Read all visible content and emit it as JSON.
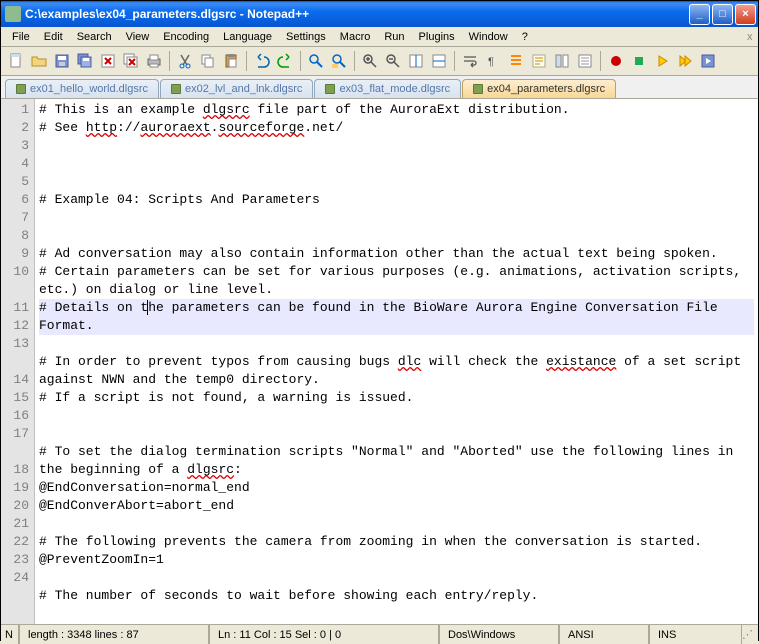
{
  "window": {
    "title": "C:\\examples\\ex04_parameters.dlgsrc - Notepad++"
  },
  "menu": {
    "items": [
      "File",
      "Edit",
      "Search",
      "View",
      "Encoding",
      "Language",
      "Settings",
      "Macro",
      "Run",
      "Plugins",
      "Window",
      "?"
    ]
  },
  "tabs": [
    {
      "label": "ex01_hello_world.dlgsrc",
      "active": false
    },
    {
      "label": "ex02_lvl_and_lnk.dlgsrc",
      "active": false
    },
    {
      "label": "ex03_flat_mode.dlgsrc",
      "active": false
    },
    {
      "label": "ex04_parameters.dlgsrc",
      "active": true
    }
  ],
  "editor": {
    "lines": [
      "# This is an example <sq>dlgsrc</sq> file part of the AuroraExt distribution.",
      "# See <sq>http</sq>://<sq>auroraext</sq>.<sq>sourceforge</sq>.net/",
      "",
      "",
      "",
      "# Example 04: Scripts And Parameters",
      "",
      "",
      "# Ad conversation may also contain information other than the actual text being spoken.",
      "# Certain parameters can be set for various purposes (e.g. animations, activation scripts, etc.) on dialog or line level.",
      "# Details on t<cur></cur>he parameters can be found in the BioWare Aurora Engine Conversation File Format.",
      "",
      "# In order to prevent typos from causing bugs <sq>dlc</sq> will check the <sq>existance</sq> of a set script against NWN and the temp0 directory.",
      "# If a script is not found, a warning is issued.",
      "",
      "",
      "# To set the dialog termination scripts \"Normal\" and \"Aborted\" use the following lines in the beginning of a <sq>dlgsrc</sq>:",
      "@EndConversation=normal_end",
      "@EndConverAbort=abort_end",
      "",
      "# The following prevents the camera from zooming in when the conversation is started.",
      "@PreventZoomIn=1",
      "",
      "# The number of seconds to wait before showing each entry/reply."
    ],
    "current_line": 11
  },
  "status": {
    "stream": "N",
    "length": "length : 3348    lines : 87",
    "pos": "Ln : 11   Col : 15   Sel : 0 | 0",
    "eol": "Dos\\Windows",
    "enc": "ANSI",
    "mode": "INS"
  }
}
